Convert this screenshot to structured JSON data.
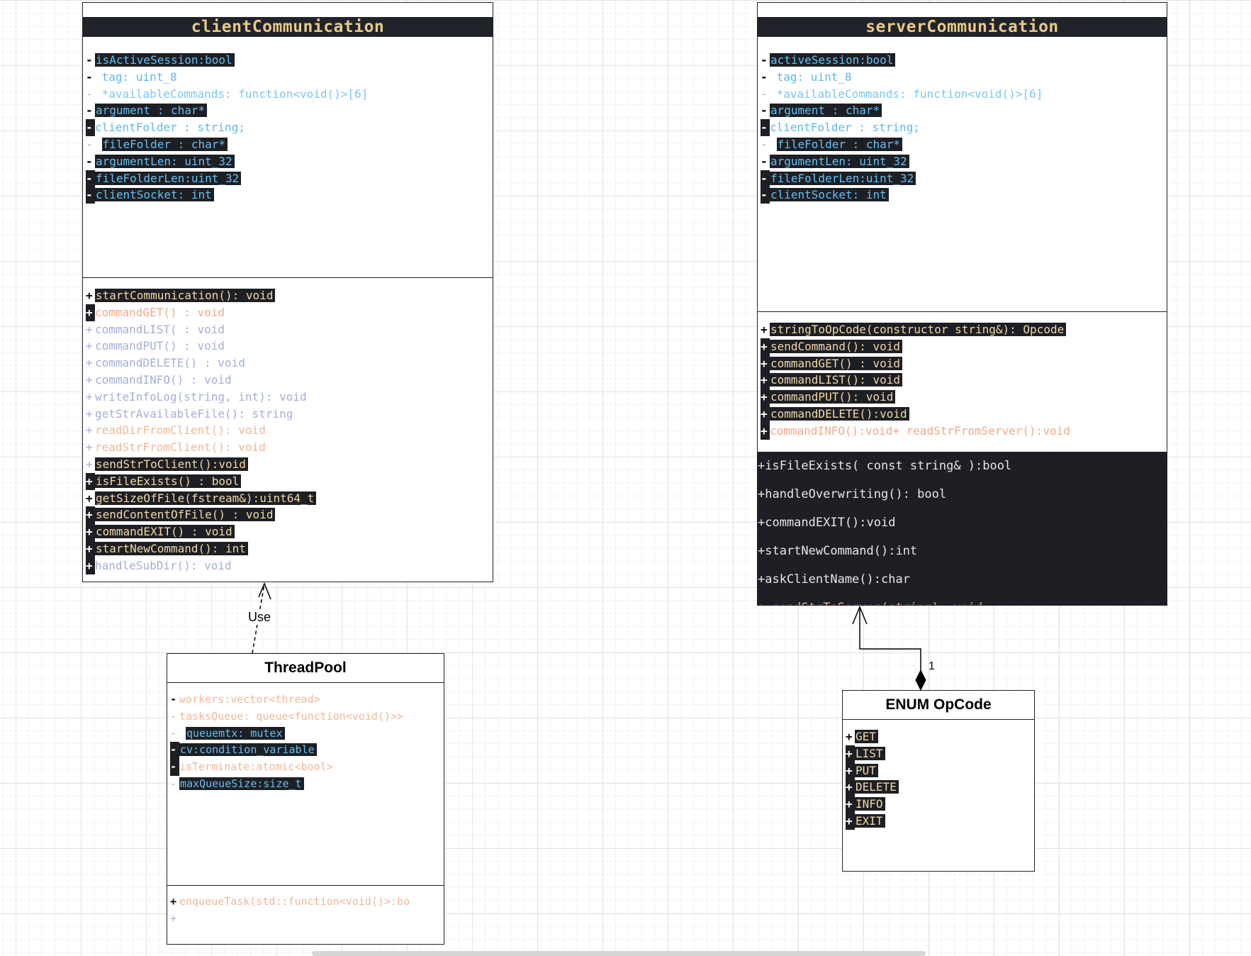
{
  "classes": {
    "client": {
      "title": "clientCommunication",
      "attributes": [
        {
          "mark": "-",
          "text": "isActiveSession:bool"
        },
        {
          "mark": "-",
          "text": "tag: uint_8"
        },
        {
          "mark": "-",
          "text": "*availableCommands: function<void()>[6]"
        },
        {
          "mark": "-",
          "text": "argument : char*"
        },
        {
          "mark": "-",
          "text": "clientFolder : string;"
        },
        {
          "mark": "-",
          "text": "fileFolder : char*"
        },
        {
          "mark": "-",
          "text": "argumentLen: uint_32"
        },
        {
          "mark": "-",
          "text": "fileFolderLen:uint_32"
        },
        {
          "mark": "-",
          "text": "clientSocket: int"
        }
      ],
      "methods": [
        {
          "mark": "+",
          "text": "startCommunication(): void"
        },
        {
          "mark": "+",
          "text": "commandGET() : void"
        },
        {
          "mark": "+",
          "text": "commandLIST( : void"
        },
        {
          "mark": "+",
          "text": "commandPUT() : void"
        },
        {
          "mark": "+",
          "text": "commandDELETE() : void"
        },
        {
          "mark": "+",
          "text": "commandINFO() : void"
        },
        {
          "mark": "+",
          "text": "writeInfoLog(string, int): void"
        },
        {
          "mark": "+",
          "text": "getStrAvailableFile(): string"
        },
        {
          "mark": "+",
          "text": "readDirFromClient(): void"
        },
        {
          "mark": "+",
          "text": "readStrFromClient(): void"
        },
        {
          "mark": "+",
          "text": "sendStrToClient():void"
        },
        {
          "mark": "+",
          "text": "isFileExists() : bool"
        },
        {
          "mark": "+",
          "text": "getSizeOfFile(fstream&):uint64_t"
        },
        {
          "mark": "+",
          "text": "sendContentOfFile() : void"
        },
        {
          "mark": "+",
          "text": "commandEXIT() : void"
        },
        {
          "mark": "+",
          "text": "startNewCommand(): int"
        },
        {
          "mark": "+",
          "text": "handleSubDir(): void"
        }
      ]
    },
    "server": {
      "title": "serverCommunication",
      "attributes": [
        {
          "mark": "-",
          "text": "activeSession:bool"
        },
        {
          "mark": "-",
          "text": "tag: uint_8"
        },
        {
          "mark": "-",
          "text": "*availableCommands: function<void()>[6]"
        },
        {
          "mark": "-",
          "text": "argument : char*"
        },
        {
          "mark": "-",
          "text": "clientFolder : string;"
        },
        {
          "mark": "-",
          "text": "fileFolder : char*"
        },
        {
          "mark": "-",
          "text": "argumentLen: uint_32"
        },
        {
          "mark": "-",
          "text": "fileFolderLen:uint_32"
        },
        {
          "mark": "-",
          "text": "clientSocket: int"
        }
      ],
      "methods": [
        {
          "mark": "+",
          "text": "stringToOpCode(constructor string&): Opcode"
        },
        {
          "mark": "+",
          "text": "sendCommand(): void"
        },
        {
          "mark": "+",
          "text": "commandGET() : void"
        },
        {
          "mark": "+",
          "text": "commandLIST(): void"
        },
        {
          "mark": "+",
          "text": "commandPUT(): void"
        },
        {
          "mark": "+",
          "text": "commandDELETE():void"
        },
        {
          "mark": "+",
          "text": "commandINFO():void+ readStrFromServer():void"
        }
      ],
      "dark_methods": [
        "+isFileExists( const string& ):bool",
        "+handleOverwriting(): bool",
        "+commandEXIT():void",
        "+startNewCommand():int",
        "+askClientName():char",
        "+ sendStrToServer(string): void"
      ]
    },
    "threadpool": {
      "title": "ThreadPool",
      "attributes": [
        {
          "mark": "-",
          "text": "workers:vector<thread>"
        },
        {
          "mark": "-",
          "text": "tasksQueue: queue<function<void()>>"
        },
        {
          "mark": "-",
          "text": "queuemtx: mutex"
        },
        {
          "mark": "-",
          "text": "cv:condition_variable"
        },
        {
          "mark": "-",
          "text": "isTerminate:atomic<bool>"
        },
        {
          "mark": "-",
          "text": "maxQueueSize:size_t"
        }
      ],
      "methods": [
        {
          "mark": "+",
          "text": "enqueueTask(std::function<void()>:bo"
        },
        {
          "mark": "+",
          "text": ""
        }
      ]
    },
    "opcode": {
      "title": "ENUM OpCode",
      "values": [
        {
          "mark": "+",
          "text": "GET"
        },
        {
          "mark": "+",
          "text": "LIST"
        },
        {
          "mark": "+",
          "text": "PUT"
        },
        {
          "mark": "+",
          "text": "DELETE"
        },
        {
          "mark": "+",
          "text": "INFO"
        },
        {
          "mark": "+",
          "text": "EXIT"
        }
      ]
    }
  },
  "relations": {
    "use_label": "Use",
    "composition_multiplicity": "1"
  }
}
